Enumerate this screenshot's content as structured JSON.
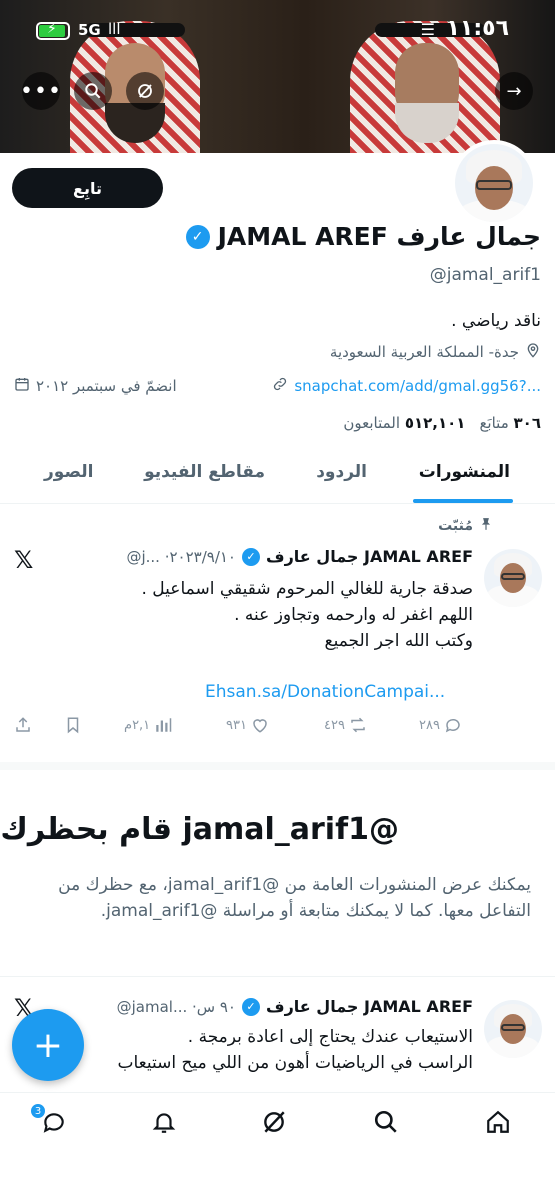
{
  "status_bar": {
    "time": "١١:٥٦",
    "network": "5G",
    "signal": "ااا"
  },
  "banner": {
    "more_label": "•••",
    "forward_label": "→"
  },
  "profile": {
    "follow_label": "تابِع",
    "display_name": "جمال عارف JAMAL AREF",
    "handle": "@jamal_arif1",
    "bio": "ناقد رياضي .",
    "location": "جدة- المملكة العربية السعودية",
    "website": "snapchat.com/add/gmal.gg56?...",
    "joined": "انضمّ في سبتمبر ٢٠١٢",
    "following_count": "٣٠٦",
    "following_label": "متابَع",
    "followers_count": "٥١٢,١٠١",
    "followers_label": "المتابعون"
  },
  "tabs": [
    {
      "label": "المنشورات",
      "active": true
    },
    {
      "label": "الردود",
      "active": false
    },
    {
      "label": "مقاطع الفيديو",
      "active": false
    },
    {
      "label": "الصور",
      "active": false
    }
  ],
  "pinned_tweet": {
    "pinned_label": "مُثبّت",
    "name": "جمال عارف JAMAL AREF",
    "handle_date": "@j... ·٢٠٢٣/٩/١٠",
    "lines": [
      "صدقة جارية للغالي المرحوم شقيقي اسماعيل .",
      "اللهم اغفر له وارحمه وتجاوز عنه .",
      "وكتب الله اجر الجميع"
    ],
    "link": "Ehsan.sa/DonationCampai...",
    "replies": "٢٨٩",
    "retweets": "٤٢٩",
    "likes": "٩٣١",
    "views": "٢,١م"
  },
  "blocked": {
    "title": "@jamal_arif1 قام بحظرك",
    "description": "يمكنك عرض المنشورات العامة من @jamal_arif1، مع حظرك من التفاعل معها. كما لا يمكنك متابعة أو مراسلة @jamal_arif1."
  },
  "second_tweet": {
    "name": "جمال عارف JAMAL AREF",
    "handle_time": "@jamal... ·٩٠ س",
    "lines": [
      "الاستيعاب عندك يحتاج إلى اعادة برمجة .",
      "الراسب في الرياضيات أهون من اللي ميح استيعاب"
    ]
  },
  "fab_label": "+",
  "bottom_nav": {
    "messages_badge": "3"
  }
}
